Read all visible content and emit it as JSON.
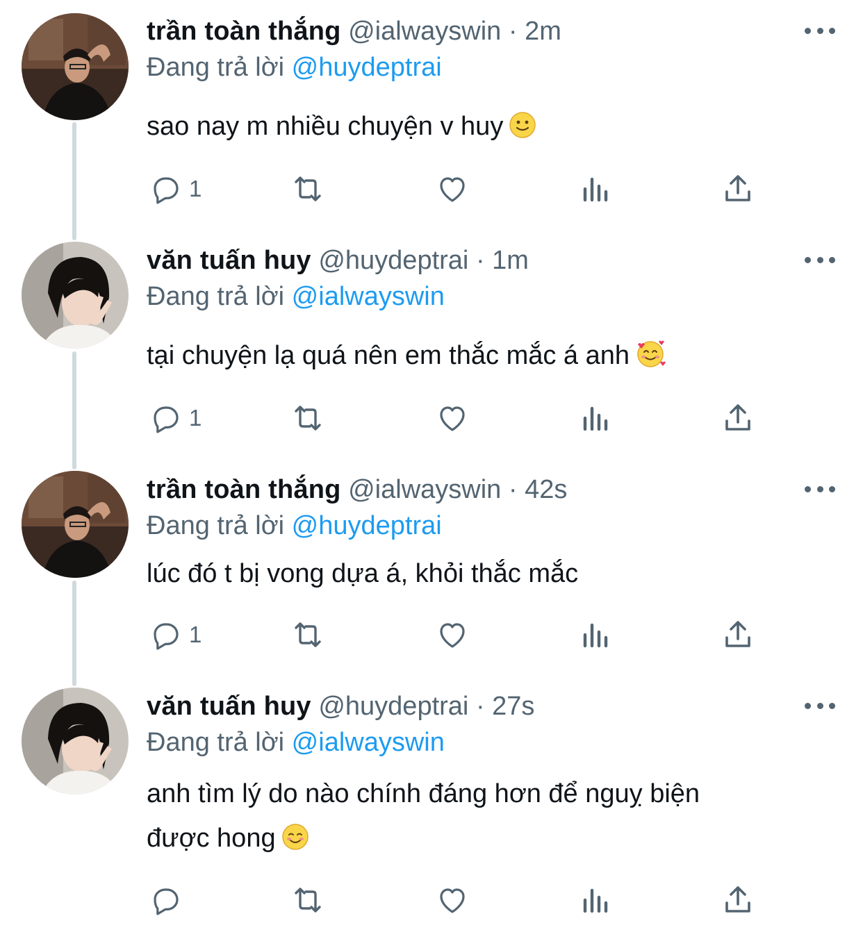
{
  "tweets": [
    {
      "name": "trần toàn thắng",
      "handle": "@ialwayswin",
      "separator": "·",
      "time": "2m",
      "reply_prefix": "Đang trả lời",
      "reply_to": "@huydeptrai",
      "text": "sao nay m nhiều chuyện v huy",
      "emoji": "slightly-smiling-face",
      "reply_count": "1"
    },
    {
      "name": "văn tuấn huy",
      "handle": "@huydeptrai",
      "separator": "·",
      "time": "1m",
      "reply_prefix": "Đang trả lời",
      "reply_to": "@ialwayswin",
      "text": "tại chuyện lạ quá nên em thắc mắc á anh",
      "emoji": "smiling-face-with-hearts",
      "reply_count": "1"
    },
    {
      "name": "trần toàn thắng",
      "handle": "@ialwayswin",
      "separator": "·",
      "time": "42s",
      "reply_prefix": "Đang trả lời",
      "reply_to": "@huydeptrai",
      "text": "lúc đó t bị vong dựa á, khỏi thắc mắc",
      "emoji": "",
      "reply_count": "1"
    },
    {
      "name": "văn tuấn huy",
      "handle": "@huydeptrai",
      "separator": "·",
      "time": "27s",
      "reply_prefix": "Đang trả lời",
      "reply_to": "@ialwayswin",
      "text_line1": "anh tìm lý do nào chính đáng hơn để nguỵ biện",
      "text_line2": "được hong",
      "emoji": "smiling-face",
      "reply_count": ""
    }
  ],
  "icons": {
    "reply": "reply-icon",
    "retweet": "retweet-icon",
    "like": "heart-icon",
    "views": "views-icon",
    "share": "share-icon",
    "more": "more-icon"
  },
  "colors": {
    "text": "#0f1419",
    "secondary": "#536471",
    "mention": "#1d9bf0",
    "thread_line": "#cfd9de"
  }
}
